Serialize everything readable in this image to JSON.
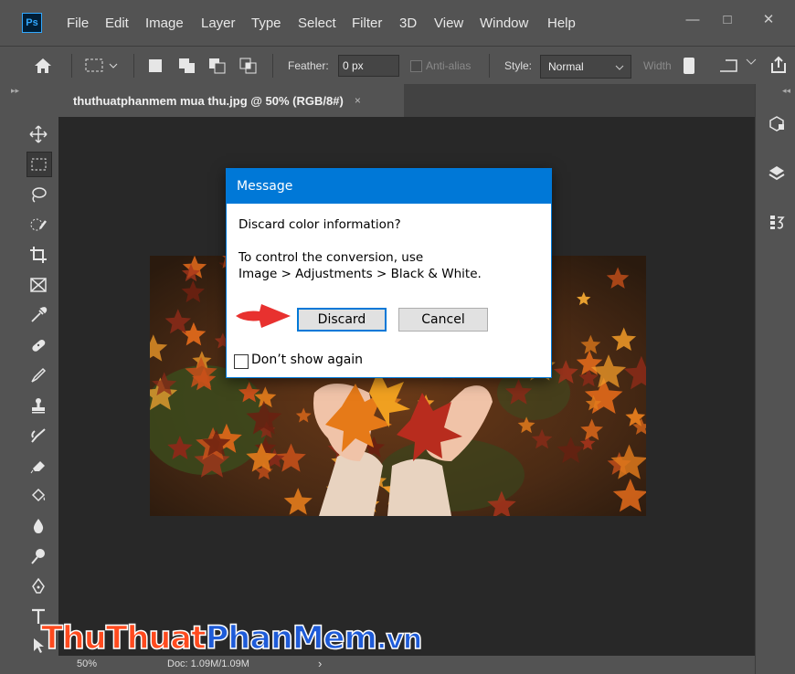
{
  "app": {
    "logo": "Ps"
  },
  "menu": [
    "File",
    "Edit",
    "Image",
    "Layer",
    "Type",
    "Select",
    "Filter",
    "3D",
    "View",
    "Window",
    "Help"
  ],
  "window_controls": {
    "minimize": "—",
    "maximize": "□",
    "close": "✕"
  },
  "options": {
    "feather_label": "Feather:",
    "feather_value": "0 px",
    "antialias_label": "Anti-alias",
    "style_label": "Style:",
    "style_value": "Normal",
    "width_label": "Width"
  },
  "tab": {
    "title": "thuthuatphanmem mua thu.jpg @ 50% (RGB/8#)",
    "close": "×"
  },
  "status": {
    "zoom": "50%",
    "doc": "Doc: 1.09M/1.09M",
    "arrow": "›"
  },
  "dialog": {
    "title": "Message",
    "question": "Discard color information?",
    "line1": "To control the conversion, use",
    "line2": "Image > Adjustments > Black & White.",
    "discard_label": "Discard",
    "cancel_label": "Cancel",
    "dont_show_label": "Don’t show again",
    "dont_show_checked": false
  },
  "watermark": {
    "part1": "Thu",
    "part2": "Thuat",
    "part3": "Phan",
    "part4": "Mem",
    "part5": ".vn"
  },
  "colors": {
    "accent": "#0078d7",
    "ps_blue": "#31a8ff",
    "arrow_red": "#e8312f"
  }
}
